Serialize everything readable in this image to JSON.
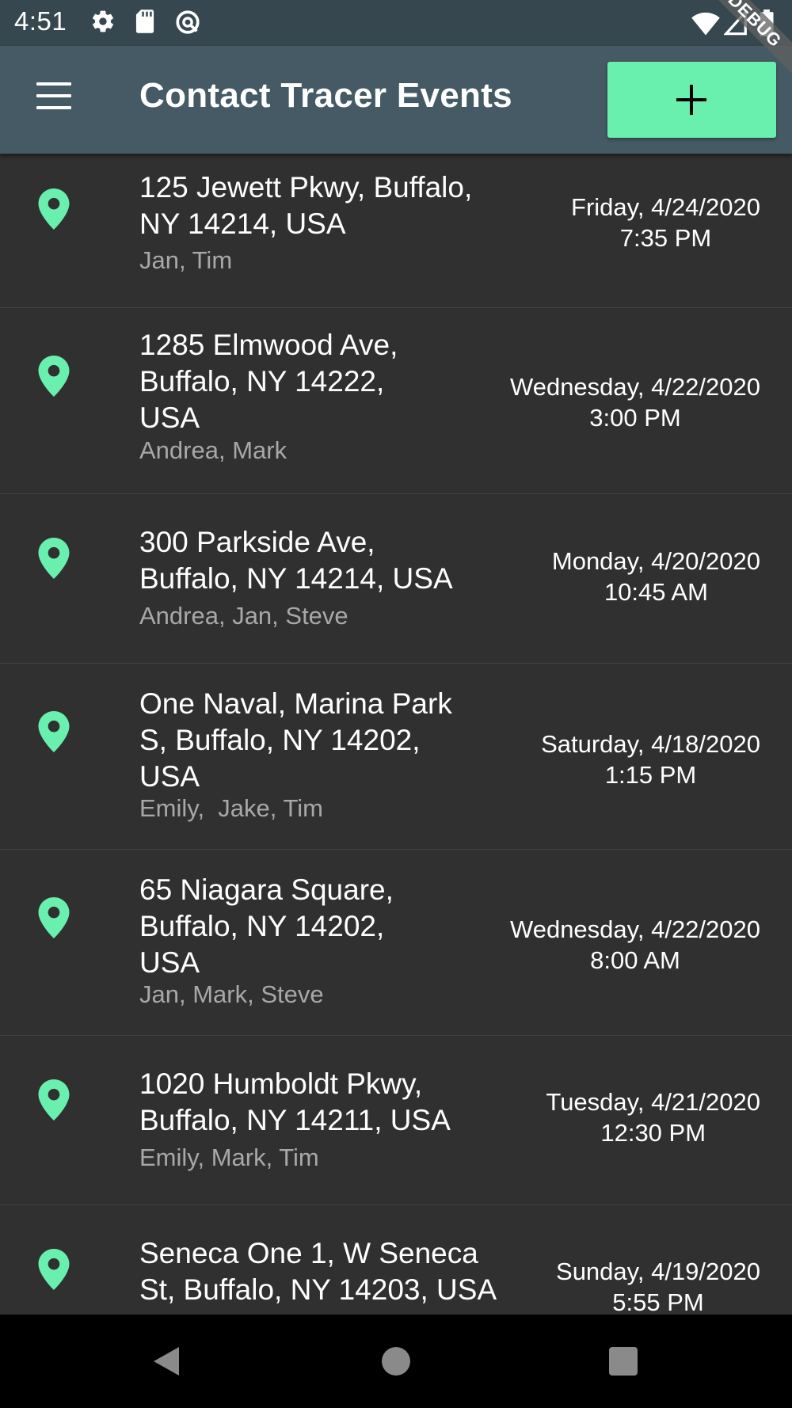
{
  "status_bar": {
    "time": "4:51",
    "icons_left": [
      "gear-icon",
      "sd-card-icon",
      "sync-icon"
    ],
    "icons_right": [
      "wifi-icon",
      "signal-icon",
      "battery-icon"
    ]
  },
  "app_bar": {
    "title": "Contact Tracer Events",
    "menu_icon": "hamburger-menu-icon",
    "add_icon": "plus-icon",
    "debug_banner": "DEBUG"
  },
  "colors": {
    "accent": "#69f0ae",
    "app_bar": "#455a64",
    "status_bar": "#37474f",
    "background": "#303030",
    "secondary_text": "#a8a8a8"
  },
  "events": [
    {
      "address_lines": [
        "125 Jewett Pkwy, Buffalo,",
        "NY 14214, USA"
      ],
      "people": "Jan, Tim",
      "date": "Friday, 4/24/2020",
      "time": "7:35 PM"
    },
    {
      "address_lines": [
        "1285 Elmwood Ave,",
        "Buffalo, NY 14222,",
        "USA"
      ],
      "people": "Andrea, Mark",
      "date": "Wednesday, 4/22/2020",
      "time": "3:00 PM"
    },
    {
      "address_lines": [
        "300 Parkside Ave,",
        "Buffalo, NY 14214, USA"
      ],
      "people": "Andrea, Jan, Steve",
      "date": "Monday, 4/20/2020",
      "time": "10:45 AM"
    },
    {
      "address_lines": [
        "One Naval, Marina Park",
        "S, Buffalo, NY 14202,",
        "USA"
      ],
      "people": "Emily,  Jake, Tim",
      "date": "Saturday, 4/18/2020",
      "time": "1:15 PM"
    },
    {
      "address_lines": [
        "65 Niagara Square,",
        "Buffalo, NY 14202,",
        "USA"
      ],
      "people": "Jan, Mark, Steve",
      "date": "Wednesday, 4/22/2020",
      "time": "8:00 AM"
    },
    {
      "address_lines": [
        "1020 Humboldt Pkwy,",
        "Buffalo, NY 14211, USA"
      ],
      "people": "Emily, Mark, Tim",
      "date": "Tuesday, 4/21/2020",
      "time": "12:30 PM"
    },
    {
      "address_lines": [
        "Seneca One 1, W Seneca",
        "St, Buffalo, NY 14203, USA"
      ],
      "people": "",
      "date": "Sunday, 4/19/2020",
      "time": "5:55 PM"
    }
  ],
  "nav_bar": {
    "back_icon": "back-triangle-icon",
    "home_icon": "home-circle-icon",
    "recents_icon": "recents-square-icon"
  }
}
